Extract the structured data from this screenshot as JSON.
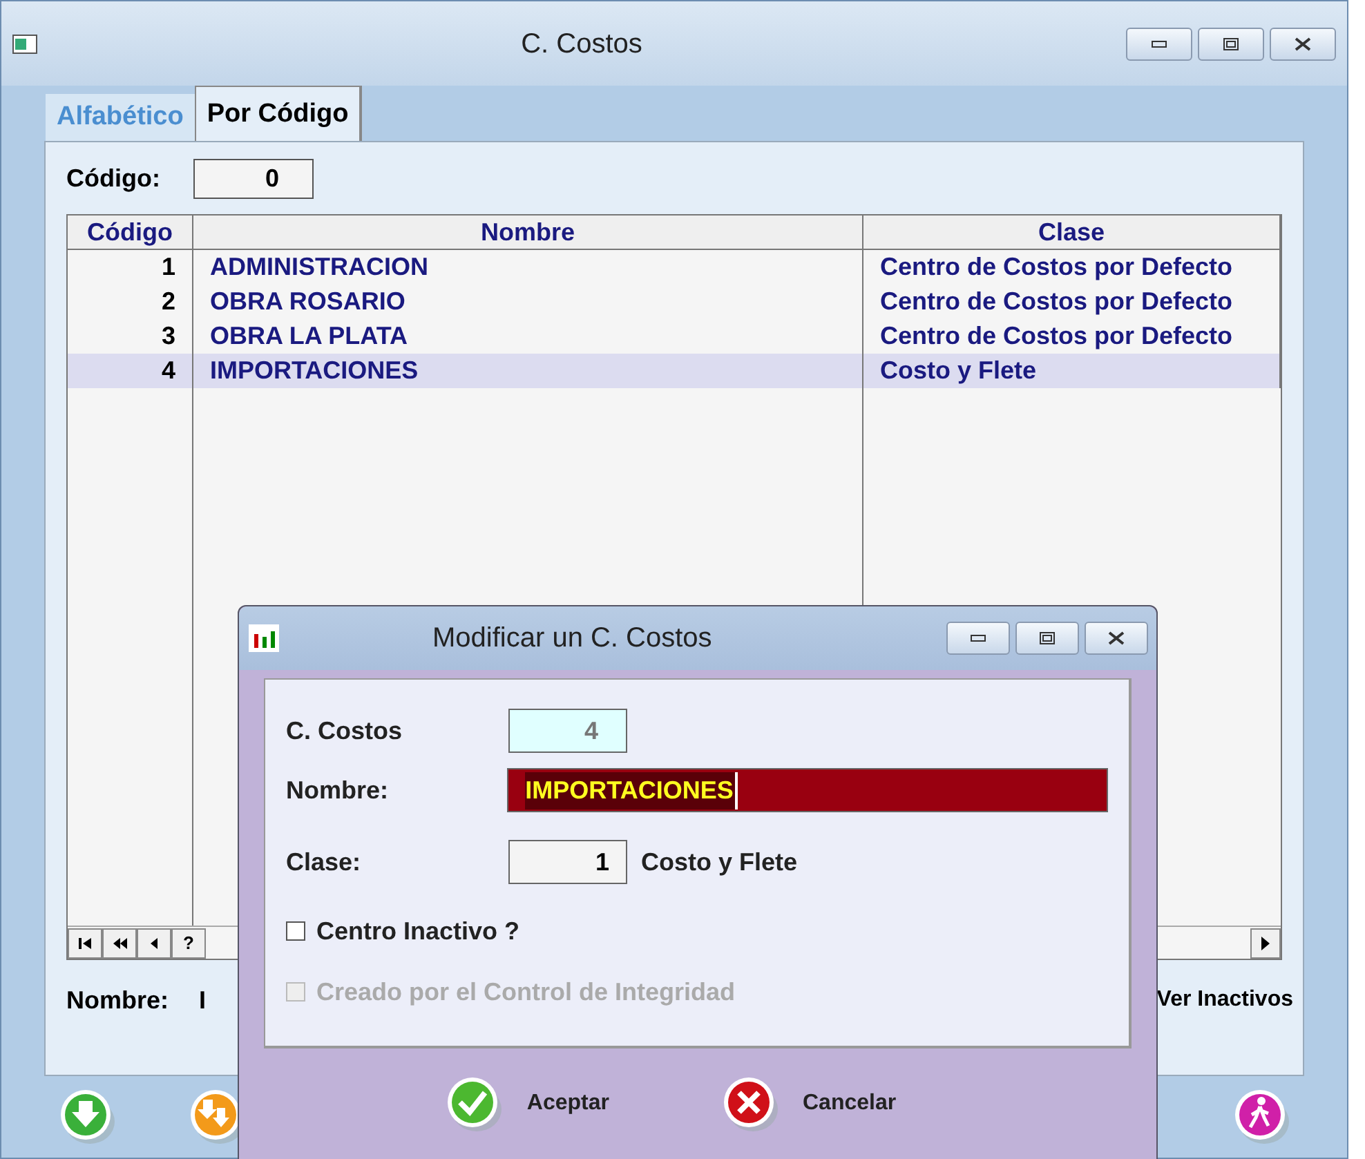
{
  "window": {
    "title": "C. Costos"
  },
  "tabs": [
    {
      "label": "Alfabético",
      "selected": false
    },
    {
      "label": "Por Código",
      "selected": true
    }
  ],
  "code_filter": {
    "label": "Código:",
    "value": "0"
  },
  "table": {
    "columns": [
      "Código",
      "Nombre",
      "Clase"
    ],
    "rows": [
      {
        "code": "1",
        "name": "ADMINISTRACION",
        "clase": "Centro de Costos por Defecto",
        "selected": false
      },
      {
        "code": "2",
        "name": "OBRA ROSARIO",
        "clase": "Centro de Costos por Defecto",
        "selected": false
      },
      {
        "code": "3",
        "name": "OBRA LA PLATA",
        "clase": "Centro de Costos por Defecto",
        "selected": false
      },
      {
        "code": "4",
        "name": "IMPORTACIONES",
        "clase": "Costo y Flete",
        "selected": true
      }
    ]
  },
  "nav_buttons": [
    "?"
  ],
  "footer": {
    "label": "Nombre:",
    "value": "I",
    "ver_inactivos": "Ver Inactivos"
  },
  "dialog": {
    "title": "Modificar un C. Costos",
    "fields": [
      {
        "label": "C. Costos",
        "value": "4",
        "kind": "readonly"
      },
      {
        "label": "Nombre:",
        "value": "IMPORTACIONES",
        "kind": "focused"
      },
      {
        "label": "Clase:",
        "value": "1",
        "kind": "lookup",
        "description": "Costo y Flete"
      }
    ],
    "checkboxes": [
      {
        "label": "Centro Inactivo ?",
        "checked": false,
        "disabled": false
      },
      {
        "label": "Creado por el Control de Integridad",
        "checked": false,
        "disabled": true
      }
    ],
    "buttons": [
      {
        "label": "Aceptar",
        "kind": "ok"
      },
      {
        "label": "Cancelar",
        "kind": "cancel"
      }
    ]
  }
}
